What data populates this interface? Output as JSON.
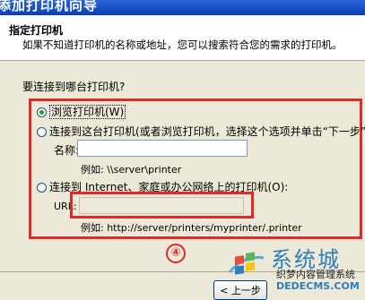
{
  "window": {
    "title": "添加打印机向导"
  },
  "header": {
    "title": "指定打印机",
    "description": "如果不知道打印机的名称或地址，您可以搜索符合您的需求的打印机。"
  },
  "prompt": "要连接到哪台打印机?",
  "options": {
    "browse": {
      "label": "浏览打印机(W)",
      "selected": true
    },
    "connect": {
      "label": "连接到这台打印机(或者浏览打印机，选择这个选项并单击“下一步”)",
      "name_label": "名称:",
      "name_value": "",
      "example": "例如: \\\\server\\printer"
    },
    "internet": {
      "label": "连接到 Internet、家庭或办公网络上的打印机(O):",
      "url_label": "URL:",
      "url_value": "",
      "example": "例如: http://server/printers/myprinter/.printer"
    }
  },
  "annotation": {
    "step": "④"
  },
  "buttons": {
    "back": "< 上一步"
  },
  "watermark": {
    "brand": "系统城",
    "slogan": "织梦内容管理系统",
    "url": "DEDECMS.COM"
  },
  "colors": {
    "highlight": "#e02a2a",
    "title_bar": "#0a3fb6"
  }
}
